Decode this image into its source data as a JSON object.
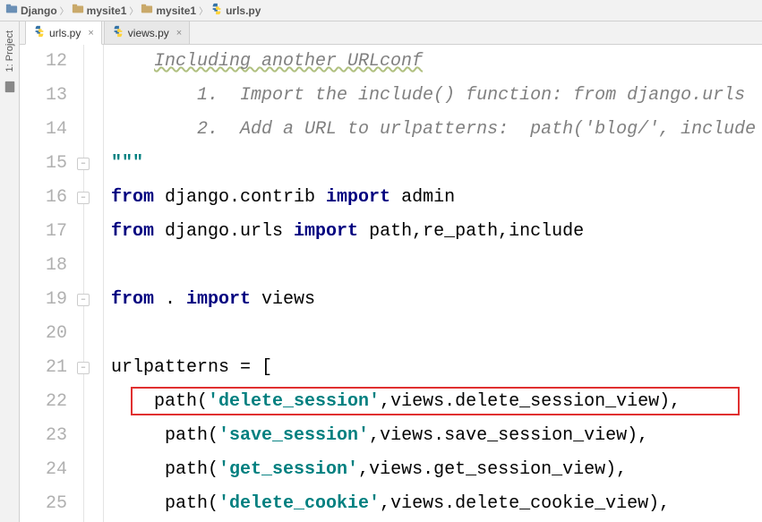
{
  "breadcrumb": [
    {
      "icon": "folder",
      "label": "Django"
    },
    {
      "icon": "folder",
      "label": "mysite1"
    },
    {
      "icon": "folder",
      "label": "mysite1"
    },
    {
      "icon": "python",
      "label": "urls.py"
    }
  ],
  "toolWindow": {
    "projectLabel": "1: Project"
  },
  "tabs": [
    {
      "label": "urls.py",
      "active": true
    },
    {
      "label": "views.py",
      "active": false
    }
  ],
  "gutterStart": 12,
  "code": {
    "lines": [
      {
        "n": 12,
        "segments": [
          {
            "cls": "c-comment underline-wavy",
            "text": "Including another URLconf"
          }
        ],
        "indent": 1
      },
      {
        "n": 13,
        "segments": [
          {
            "cls": "c-comment",
            "text": "1.  Import the include() function: from django.urls "
          }
        ],
        "indent": 2
      },
      {
        "n": 14,
        "segments": [
          {
            "cls": "c-comment",
            "text": "2.  Add a URL to urlpatterns:  path('blog/', include"
          }
        ],
        "indent": 2
      },
      {
        "n": 15,
        "segments": [
          {
            "cls": "c-string",
            "text": "\"\"\""
          }
        ],
        "indent": 0,
        "foldEnd": true
      },
      {
        "n": 16,
        "segments": [
          {
            "cls": "c-keyword",
            "text": "from "
          },
          {
            "cls": "c-plain",
            "text": "django.contrib "
          },
          {
            "cls": "c-keyword",
            "text": "import "
          },
          {
            "cls": "c-plain",
            "text": "admin"
          }
        ],
        "indent": 0,
        "foldStart": true
      },
      {
        "n": 17,
        "segments": [
          {
            "cls": "c-keyword",
            "text": "from "
          },
          {
            "cls": "c-plain",
            "text": "django.urls "
          },
          {
            "cls": "c-keyword",
            "text": "import "
          },
          {
            "cls": "c-plain",
            "text": "path,re_path,include"
          }
        ],
        "indent": 0
      },
      {
        "n": 18,
        "segments": [],
        "indent": 0
      },
      {
        "n": 19,
        "segments": [
          {
            "cls": "c-keyword",
            "text": "from "
          },
          {
            "cls": "c-plain",
            "text": ". "
          },
          {
            "cls": "c-keyword",
            "text": "import "
          },
          {
            "cls": "c-plain",
            "text": "views"
          }
        ],
        "indent": 0,
        "foldEnd": true
      },
      {
        "n": 20,
        "segments": [],
        "indent": 0
      },
      {
        "n": 21,
        "segments": [
          {
            "cls": "c-plain",
            "text": "urlpatterns = ["
          }
        ],
        "indent": 0,
        "foldStart": true
      },
      {
        "n": 22,
        "segments": [
          {
            "cls": "c-plain",
            "text": "path("
          },
          {
            "cls": "c-string",
            "text": "'delete_session'"
          },
          {
            "cls": "c-plain",
            "text": ",views.delete_session_view),"
          }
        ],
        "indent": 1,
        "highlighted": true
      },
      {
        "n": 23,
        "segments": [
          {
            "cls": "c-plain",
            "text": " path("
          },
          {
            "cls": "c-string",
            "text": "'save_session'"
          },
          {
            "cls": "c-plain",
            "text": ",views.save_session_view),"
          }
        ],
        "indent": 1
      },
      {
        "n": 24,
        "segments": [
          {
            "cls": "c-plain",
            "text": " path("
          },
          {
            "cls": "c-string",
            "text": "'get_session'"
          },
          {
            "cls": "c-plain",
            "text": ",views.get_session_view),"
          }
        ],
        "indent": 1
      },
      {
        "n": 25,
        "segments": [
          {
            "cls": "c-plain",
            "text": " path("
          },
          {
            "cls": "c-string",
            "text": "'delete_cookie'"
          },
          {
            "cls": "c-plain",
            "text": ",views.delete_cookie_view),"
          }
        ],
        "indent": 1
      }
    ]
  },
  "watermark": ""
}
